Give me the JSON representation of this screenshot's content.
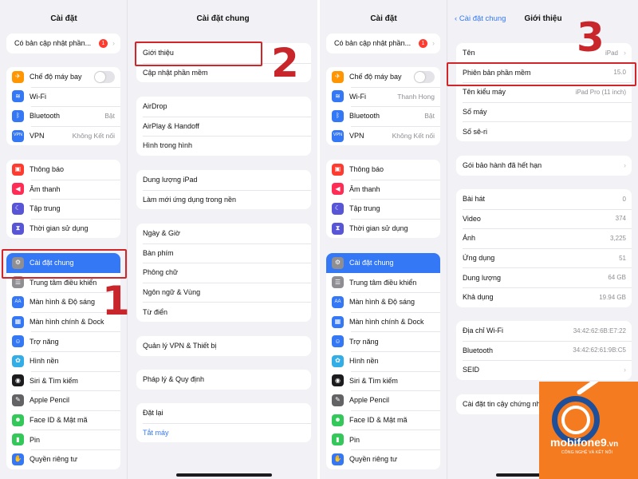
{
  "left_panel": {
    "sidebar": {
      "title": "Cài đặt",
      "update_row": {
        "label": "Có bản cập nhật phần...",
        "badge": "1"
      },
      "connectivity": [
        {
          "icon": "airplane-icon",
          "label": "Chế độ máy bay",
          "value": ""
        },
        {
          "icon": "wifi-icon",
          "label": "Wi-Fi",
          "value": ""
        },
        {
          "icon": "bluetooth-icon",
          "label": "Bluetooth",
          "value": "Bật"
        },
        {
          "icon": "vpn-icon",
          "label": "VPN",
          "value": "Không Kết nối"
        }
      ],
      "notifications": [
        {
          "icon": "notifications-icon",
          "label": "Thông báo"
        },
        {
          "icon": "sounds-icon",
          "label": "Âm thanh"
        },
        {
          "icon": "focus-icon",
          "label": "Tập trung"
        },
        {
          "icon": "screen-time-icon",
          "label": "Thời gian sử dụng"
        }
      ],
      "general": [
        {
          "icon": "gear-icon",
          "label": "Cài đặt chung"
        },
        {
          "icon": "control-center-icon",
          "label": "Trung tâm điều khiển"
        },
        {
          "icon": "display-icon",
          "label": "Màn hình & Độ sáng"
        },
        {
          "icon": "home-screen-icon",
          "label": "Màn hình chính & Dock"
        },
        {
          "icon": "accessibility-icon",
          "label": "Trợ năng"
        },
        {
          "icon": "wallpaper-icon",
          "label": "Hình nền"
        },
        {
          "icon": "siri-icon",
          "label": "Siri & Tìm kiếm"
        },
        {
          "icon": "apple-pencil-icon",
          "label": "Apple Pencil"
        },
        {
          "icon": "face-id-icon",
          "label": "Face ID & Mật mã"
        },
        {
          "icon": "battery-icon",
          "label": "Pin"
        },
        {
          "icon": "privacy-icon",
          "label": "Quyền riêng tư"
        }
      ]
    },
    "detail": {
      "title": "Cài đặt chung",
      "group1": [
        "Giới thiệu",
        "Cập nhật phần mềm"
      ],
      "group2": [
        "AirDrop",
        "AirPlay & Handoff",
        "Hình trong hình"
      ],
      "group3": [
        "Dung lượng iPad",
        "Làm mới ứng dụng trong nền"
      ],
      "group4": [
        "Ngày & Giờ",
        "Bàn phím",
        "Phông chữ",
        "Ngôn ngữ & Vùng",
        "Từ điển"
      ],
      "group5": [
        "Quản lý VPN & Thiết bị"
      ],
      "group6": [
        "Pháp lý & Quy định"
      ],
      "group7": [
        "Đặt lại",
        "Tắt máy"
      ]
    },
    "steps": {
      "step1": "1",
      "step2": "2"
    }
  },
  "right_panel": {
    "sidebar": {
      "title": "Cài đặt",
      "update_row": {
        "label": "Có bản cập nhật phần...",
        "badge": "1"
      },
      "connectivity": [
        {
          "label": "Chế độ máy bay",
          "value": ""
        },
        {
          "label": "Wi-Fi",
          "value": "Thanh Hong"
        },
        {
          "label": "Bluetooth",
          "value": "Bật"
        },
        {
          "label": "VPN",
          "value": "Không Kết nối"
        }
      ],
      "notifications": [
        "Thông báo",
        "Âm thanh",
        "Tập trung",
        "Thời gian sử dụng"
      ],
      "general": [
        "Cài đặt chung",
        "Trung tâm điều khiển",
        "Màn hình & Độ sáng",
        "Màn hình chính & Dock",
        "Trợ năng",
        "Hình nền",
        "Siri & Tìm kiếm",
        "Apple Pencil",
        "Face ID & Mật mã",
        "Pin",
        "Quyền riêng tư"
      ]
    },
    "detail": {
      "back_label": "Cài đặt chung",
      "title": "Giới thiệu",
      "info": [
        {
          "label": "Tên",
          "value": "iPad"
        },
        {
          "label": "Phiên bản phần mềm",
          "value": "15.0"
        },
        {
          "label": "Tên kiểu máy",
          "value": "iPad Pro (11 inch)"
        },
        {
          "label": "Số máy",
          "value": ""
        },
        {
          "label": "Số sê-ri",
          "value": ""
        }
      ],
      "warranty": {
        "label": "Gói bảo hành đã hết hạn"
      },
      "stats": [
        {
          "label": "Bài hát",
          "value": "0"
        },
        {
          "label": "Video",
          "value": "374"
        },
        {
          "label": "Ảnh",
          "value": "3,225"
        },
        {
          "label": "Ứng dụng",
          "value": "51"
        },
        {
          "label": "Dung lượng",
          "value": "64 GB"
        },
        {
          "label": "Khả dụng",
          "value": "19.94 GB"
        }
      ],
      "network": [
        {
          "label": "Địa chỉ Wi-Fi",
          "value": "34:42:62:6B:E7:22"
        },
        {
          "label": "Bluetooth",
          "value": "34:42:62:61:9B:C5"
        },
        {
          "label": "SEID",
          "value": ""
        }
      ],
      "trust": {
        "label": "Cài đặt tin cậy chứng nhận"
      }
    },
    "steps": {
      "step3": "3"
    }
  },
  "logo": {
    "name": "mobifone9",
    "suffix": ".vn",
    "tagline": "CÔNG NGHỆ VÀ KẾT NỐI"
  },
  "colors": {
    "accent": "#3478f6",
    "highlight": "#d0262a",
    "logo_bg": "#f47b20"
  }
}
